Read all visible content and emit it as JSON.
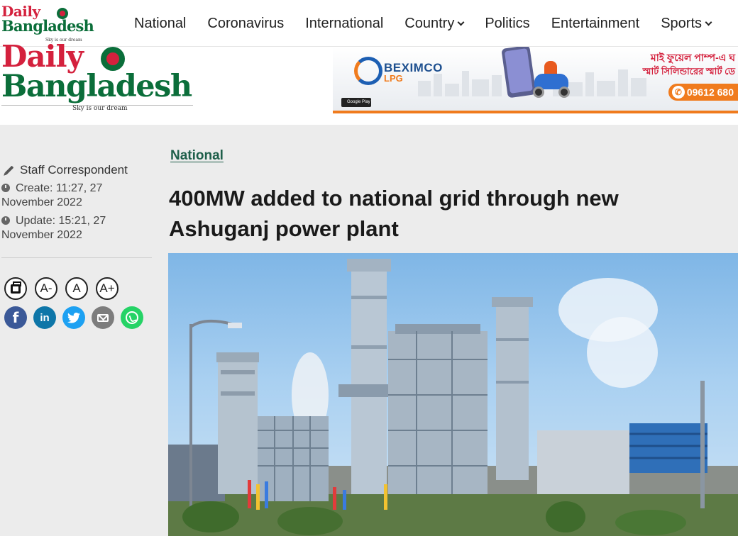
{
  "nav": {
    "logo": {
      "line1": "Daily",
      "line2": "Bangladesh",
      "tagline": "Sky is our dream"
    },
    "items": [
      {
        "label": "National",
        "has_dropdown": false
      },
      {
        "label": "Coronavirus",
        "has_dropdown": false
      },
      {
        "label": "International",
        "has_dropdown": false
      },
      {
        "label": "Country",
        "has_dropdown": true
      },
      {
        "label": "Politics",
        "has_dropdown": false
      },
      {
        "label": "Entertainment",
        "has_dropdown": false
      },
      {
        "label": "Sports",
        "has_dropdown": true
      }
    ]
  },
  "header": {
    "logo": {
      "line1": "Daily",
      "line2": "Bangladesh",
      "tagline": "Sky is our dream"
    },
    "ad": {
      "brand": "BEXIMCO",
      "sub": "LPG",
      "bangla_line1": "মাই ফুয়েল পাম্প-এ ঘ",
      "bangla_line2": "স্মার্ট সিলিন্ডারের স্মার্ট ডে",
      "phone": "09612 680",
      "store_badge": "Google Play"
    }
  },
  "article": {
    "category": "National",
    "author": "Staff Correspondent",
    "created": "Create: 11:27, 27 November 2022",
    "updated": "Update: 15:21, 27 November 2022",
    "headline": "400MW added to national grid through new Ashuganj power plant",
    "font_tools": [
      "A-",
      "A",
      "A+"
    ],
    "social": [
      {
        "name": "facebook",
        "glyph": "f"
      },
      {
        "name": "linkedin",
        "glyph": "in"
      },
      {
        "name": "twitter",
        "glyph": "🐦"
      },
      {
        "name": "email",
        "glyph": ""
      },
      {
        "name": "whatsapp",
        "glyph": ""
      }
    ]
  },
  "colors": {
    "brand_red": "#d4213d",
    "brand_green": "#0b6e3a",
    "category_green": "#1e5f4a",
    "ad_orange": "#f07b1d",
    "content_bg": "#ececec"
  }
}
